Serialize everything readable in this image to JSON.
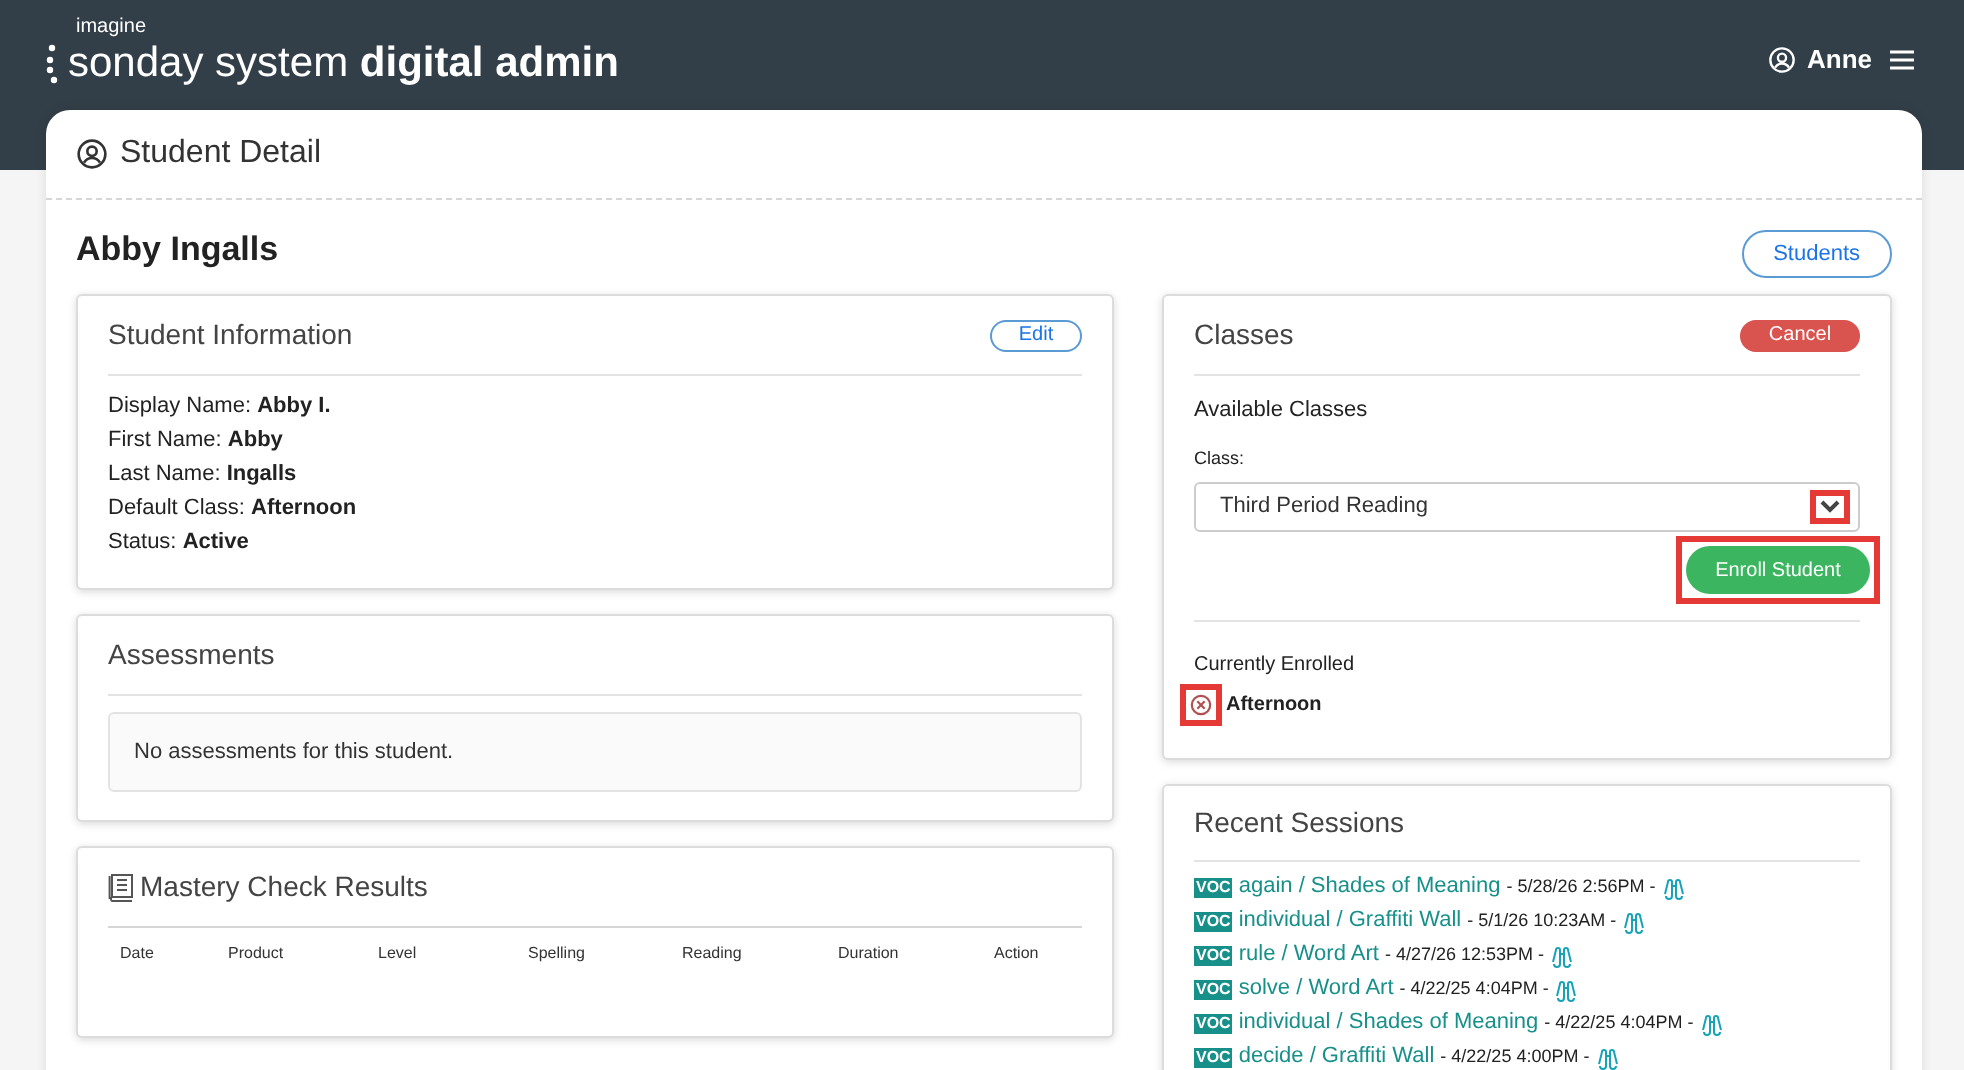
{
  "header": {
    "brand_small": "imagine",
    "brand_light": "sonday system",
    "brand_bold": "digital admin",
    "user": "Anne"
  },
  "page": {
    "title": "Student Detail",
    "student_name": "Abby Ingalls",
    "back_button": "Students"
  },
  "student_info": {
    "title": "Student Information",
    "edit_button": "Edit",
    "fields": [
      {
        "label": "Display Name:",
        "value": "Abby I."
      },
      {
        "label": "First Name:",
        "value": "Abby"
      },
      {
        "label": "Last Name:",
        "value": "Ingalls"
      },
      {
        "label": "Default Class:",
        "value": "Afternoon"
      },
      {
        "label": "Status:",
        "value": "Active"
      }
    ]
  },
  "assessments": {
    "title": "Assessments",
    "empty_message": "No assessments for this student."
  },
  "mastery": {
    "title": "Mastery Check Results",
    "columns": [
      "Date",
      "Product",
      "Level",
      "Spelling",
      "Reading",
      "Duration",
      "Action"
    ]
  },
  "classes": {
    "title": "Classes",
    "cancel_button": "Cancel",
    "available_heading": "Available Classes",
    "class_label": "Class:",
    "class_value": "Third Period Reading",
    "dropdown_highlighted": true,
    "enroll_button": "Enroll Student",
    "enroll_highlighted": true,
    "enrolled_heading": "Currently Enrolled",
    "enrolled": [
      {
        "name": "Afternoon",
        "highlighted": true
      }
    ]
  },
  "recent_sessions": {
    "title": "Recent Sessions",
    "items": [
      {
        "badge": "VOC",
        "activity": "again / Shades of Meaning",
        "time": "- 5/28/26 2:56PM -"
      },
      {
        "badge": "VOC",
        "activity": "individual / Graffiti Wall",
        "time": "- 5/1/26 10:23AM -"
      },
      {
        "badge": "VOC",
        "activity": "rule / Word Art",
        "time": "- 4/27/26 12:53PM -"
      },
      {
        "badge": "VOC",
        "activity": "solve / Word Art",
        "time": "- 4/22/25 4:04PM -"
      },
      {
        "badge": "VOC",
        "activity": "individual / Shades of Meaning",
        "time": "- 4/22/25 4:04PM -"
      },
      {
        "badge": "VOC",
        "activity": "decide / Graffiti Wall",
        "time": "- 4/22/25 4:00PM -"
      }
    ]
  }
}
